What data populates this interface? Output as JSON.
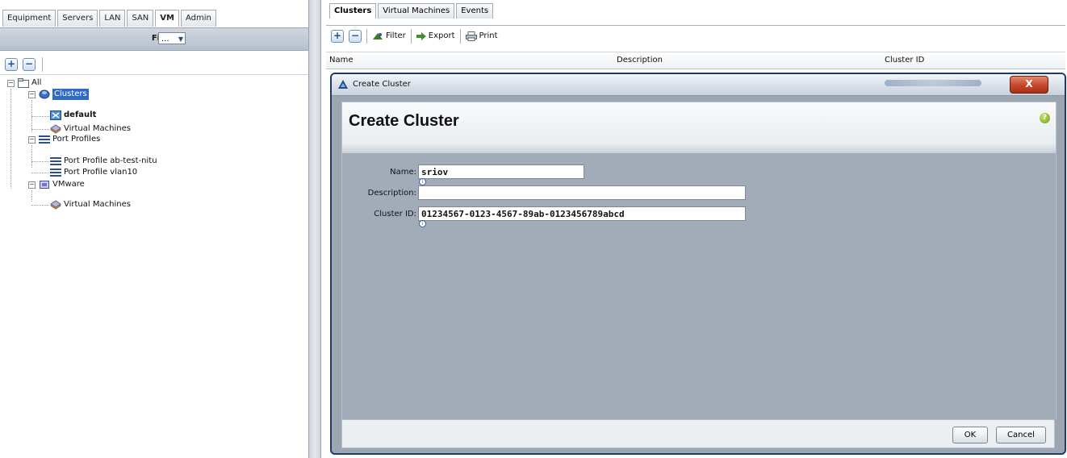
{
  "nav": {
    "tabs": [
      "Equipment",
      "Servers",
      "LAN",
      "SAN",
      "VM",
      "Admin"
    ],
    "active_tab": "VM"
  },
  "filter": {
    "label": "Filter:",
    "value": "..."
  },
  "tree": {
    "all": "All",
    "clusters": "Clusters",
    "default": "default",
    "cluster_vms": "Virtual Machines",
    "port_profiles": "Port Profiles",
    "pp1": "Port Profile ab-test-nitu",
    "pp2": "Port Profile vlan10",
    "vmware": "VMware",
    "vmware_vms": "Virtual Machines"
  },
  "content_tabs": [
    "Clusters",
    "Virtual Machines",
    "Events"
  ],
  "toolbar": {
    "filter": "Filter",
    "export": "Export",
    "print": "Print"
  },
  "grid": {
    "columns": [
      "Name",
      "Description",
      "Cluster ID"
    ]
  },
  "dialog": {
    "window_title": "Create Cluster",
    "heading": "Create Cluster",
    "close_label": "X",
    "fields": {
      "name_label": "Name:",
      "name_value": "sriov",
      "description_label": "Description:",
      "description_value": "",
      "cluster_id_label": "Cluster ID:",
      "cluster_id_value": "01234567-0123-4567-89ab-0123456789abcd"
    },
    "ok_label": "OK",
    "cancel_label": "Cancel"
  }
}
